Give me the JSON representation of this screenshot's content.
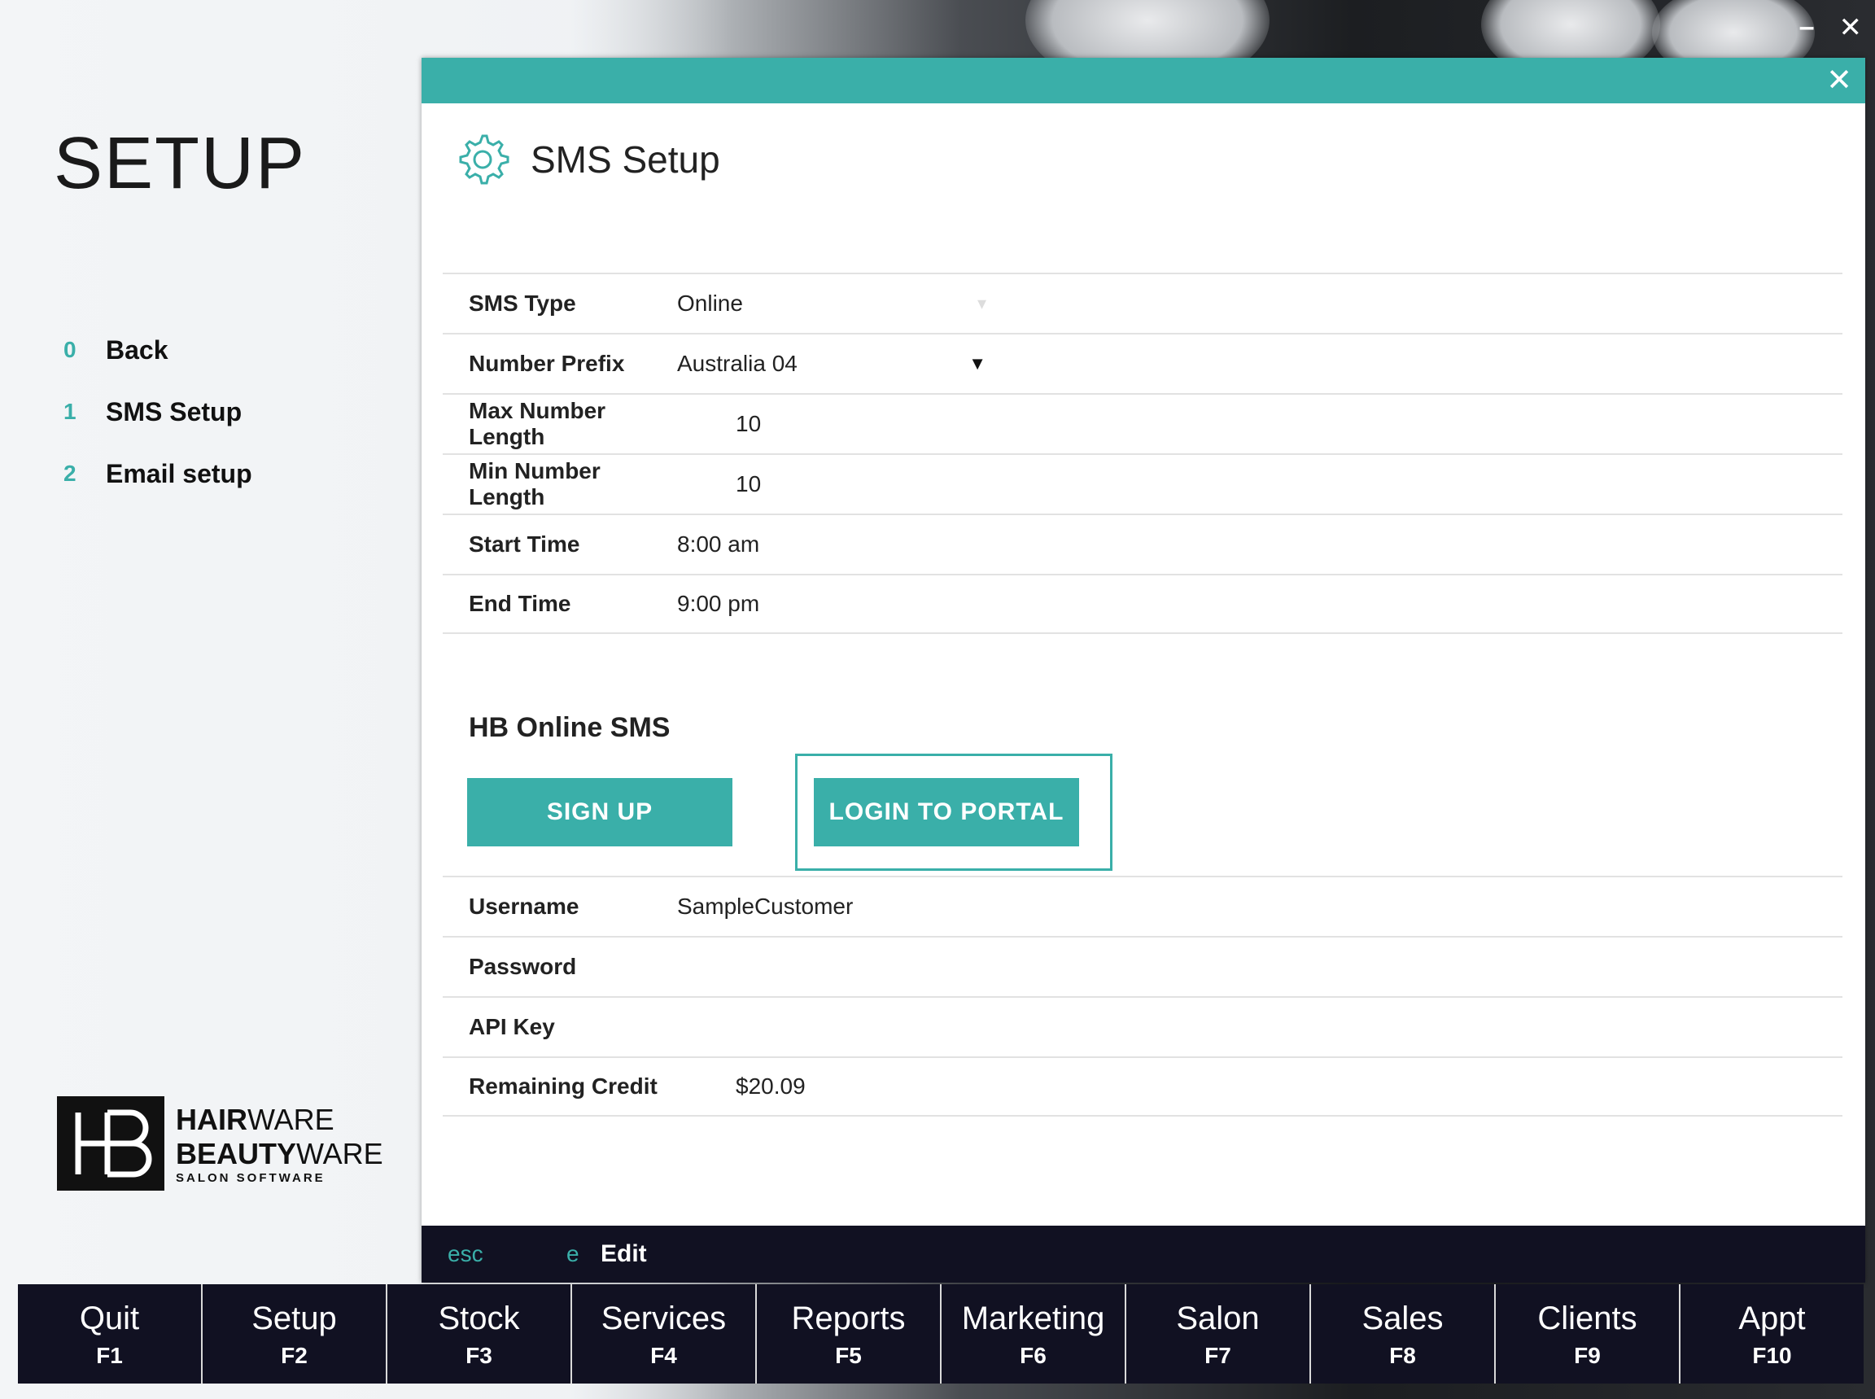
{
  "page": {
    "title": "SETUP"
  },
  "sidenav": {
    "items": [
      {
        "num": "0",
        "label": "Back"
      },
      {
        "num": "1",
        "label": "SMS Setup"
      },
      {
        "num": "2",
        "label": "Email setup"
      }
    ]
  },
  "logo": {
    "line1_bold": "HAIR",
    "line1_rest": "WARE",
    "line2_bold": "BEAUTY",
    "line2_rest": "WARE",
    "sub": "SALON SOFTWARE"
  },
  "dialog": {
    "title": "SMS Setup",
    "close": "✕",
    "fields": [
      {
        "label": "SMS Type",
        "value": "Online"
      },
      {
        "label": "Number Prefix",
        "value": "Australia 04"
      },
      {
        "label": "Max Number Length",
        "value": "10"
      },
      {
        "label": "Min Number Length",
        "value": "10"
      },
      {
        "label": "Start Time",
        "value": "8:00 am"
      },
      {
        "label": "End Time",
        "value": "9:00 pm"
      }
    ],
    "online_section": {
      "title": "HB Online SMS",
      "signup": "SIGN UP",
      "login": "LOGIN TO PORTAL"
    },
    "account": [
      {
        "label": "Username",
        "value": "SampleCustomer"
      },
      {
        "label": "Password",
        "value": ""
      },
      {
        "label": "API Key",
        "value": ""
      },
      {
        "label": "Remaining Credit",
        "value": "$20.09"
      }
    ],
    "footer": {
      "esc": "esc",
      "e": "e",
      "edit": "Edit"
    }
  },
  "window": {
    "minimize": "–",
    "close": "✕"
  },
  "fbar": [
    {
      "name": "Quit",
      "key": "F1"
    },
    {
      "name": "Setup",
      "key": "F2"
    },
    {
      "name": "Stock",
      "key": "F3"
    },
    {
      "name": "Services",
      "key": "F4"
    },
    {
      "name": "Reports",
      "key": "F5"
    },
    {
      "name": "Marketing",
      "key": "F6"
    },
    {
      "name": "Salon",
      "key": "F7"
    },
    {
      "name": "Sales",
      "key": "F8"
    },
    {
      "name": "Clients",
      "key": "F9"
    },
    {
      "name": "Appt",
      "key": "F10"
    }
  ],
  "colors": {
    "accent": "#3aafa9",
    "dark_bar": "#111122"
  }
}
